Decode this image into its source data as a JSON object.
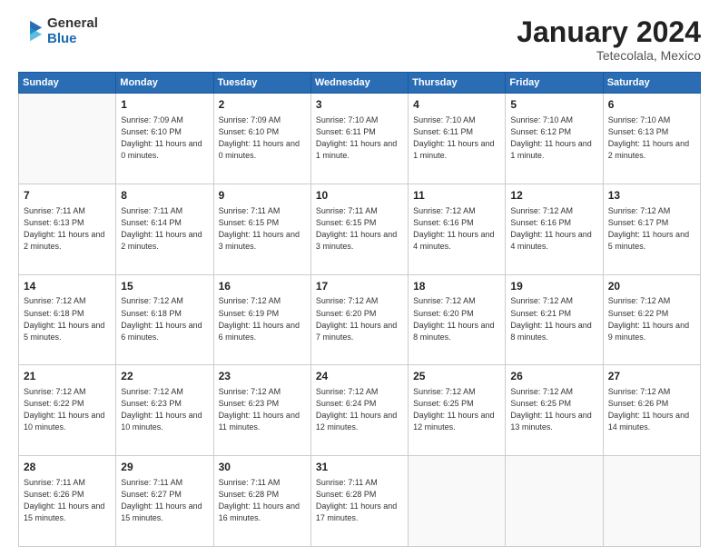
{
  "logo": {
    "general": "General",
    "blue": "Blue"
  },
  "title": {
    "month": "January 2024",
    "location": "Tetecolala, Mexico"
  },
  "days_of_week": [
    "Sunday",
    "Monday",
    "Tuesday",
    "Wednesday",
    "Thursday",
    "Friday",
    "Saturday"
  ],
  "weeks": [
    [
      {
        "day": "",
        "info": ""
      },
      {
        "day": "1",
        "info": "Sunrise: 7:09 AM\nSunset: 6:10 PM\nDaylight: 11 hours\nand 0 minutes."
      },
      {
        "day": "2",
        "info": "Sunrise: 7:09 AM\nSunset: 6:10 PM\nDaylight: 11 hours\nand 0 minutes."
      },
      {
        "day": "3",
        "info": "Sunrise: 7:10 AM\nSunset: 6:11 PM\nDaylight: 11 hours\nand 1 minute."
      },
      {
        "day": "4",
        "info": "Sunrise: 7:10 AM\nSunset: 6:11 PM\nDaylight: 11 hours\nand 1 minute."
      },
      {
        "day": "5",
        "info": "Sunrise: 7:10 AM\nSunset: 6:12 PM\nDaylight: 11 hours\nand 1 minute."
      },
      {
        "day": "6",
        "info": "Sunrise: 7:10 AM\nSunset: 6:13 PM\nDaylight: 11 hours\nand 2 minutes."
      }
    ],
    [
      {
        "day": "7",
        "info": "Sunrise: 7:11 AM\nSunset: 6:13 PM\nDaylight: 11 hours\nand 2 minutes."
      },
      {
        "day": "8",
        "info": "Sunrise: 7:11 AM\nSunset: 6:14 PM\nDaylight: 11 hours\nand 2 minutes."
      },
      {
        "day": "9",
        "info": "Sunrise: 7:11 AM\nSunset: 6:15 PM\nDaylight: 11 hours\nand 3 minutes."
      },
      {
        "day": "10",
        "info": "Sunrise: 7:11 AM\nSunset: 6:15 PM\nDaylight: 11 hours\nand 3 minutes."
      },
      {
        "day": "11",
        "info": "Sunrise: 7:12 AM\nSunset: 6:16 PM\nDaylight: 11 hours\nand 4 minutes."
      },
      {
        "day": "12",
        "info": "Sunrise: 7:12 AM\nSunset: 6:16 PM\nDaylight: 11 hours\nand 4 minutes."
      },
      {
        "day": "13",
        "info": "Sunrise: 7:12 AM\nSunset: 6:17 PM\nDaylight: 11 hours\nand 5 minutes."
      }
    ],
    [
      {
        "day": "14",
        "info": "Sunrise: 7:12 AM\nSunset: 6:18 PM\nDaylight: 11 hours\nand 5 minutes."
      },
      {
        "day": "15",
        "info": "Sunrise: 7:12 AM\nSunset: 6:18 PM\nDaylight: 11 hours\nand 6 minutes."
      },
      {
        "day": "16",
        "info": "Sunrise: 7:12 AM\nSunset: 6:19 PM\nDaylight: 11 hours\nand 6 minutes."
      },
      {
        "day": "17",
        "info": "Sunrise: 7:12 AM\nSunset: 6:20 PM\nDaylight: 11 hours\nand 7 minutes."
      },
      {
        "day": "18",
        "info": "Sunrise: 7:12 AM\nSunset: 6:20 PM\nDaylight: 11 hours\nand 8 minutes."
      },
      {
        "day": "19",
        "info": "Sunrise: 7:12 AM\nSunset: 6:21 PM\nDaylight: 11 hours\nand 8 minutes."
      },
      {
        "day": "20",
        "info": "Sunrise: 7:12 AM\nSunset: 6:22 PM\nDaylight: 11 hours\nand 9 minutes."
      }
    ],
    [
      {
        "day": "21",
        "info": "Sunrise: 7:12 AM\nSunset: 6:22 PM\nDaylight: 11 hours\nand 10 minutes."
      },
      {
        "day": "22",
        "info": "Sunrise: 7:12 AM\nSunset: 6:23 PM\nDaylight: 11 hours\nand 10 minutes."
      },
      {
        "day": "23",
        "info": "Sunrise: 7:12 AM\nSunset: 6:23 PM\nDaylight: 11 hours\nand 11 minutes."
      },
      {
        "day": "24",
        "info": "Sunrise: 7:12 AM\nSunset: 6:24 PM\nDaylight: 11 hours\nand 12 minutes."
      },
      {
        "day": "25",
        "info": "Sunrise: 7:12 AM\nSunset: 6:25 PM\nDaylight: 11 hours\nand 12 minutes."
      },
      {
        "day": "26",
        "info": "Sunrise: 7:12 AM\nSunset: 6:25 PM\nDaylight: 11 hours\nand 13 minutes."
      },
      {
        "day": "27",
        "info": "Sunrise: 7:12 AM\nSunset: 6:26 PM\nDaylight: 11 hours\nand 14 minutes."
      }
    ],
    [
      {
        "day": "28",
        "info": "Sunrise: 7:11 AM\nSunset: 6:26 PM\nDaylight: 11 hours\nand 15 minutes."
      },
      {
        "day": "29",
        "info": "Sunrise: 7:11 AM\nSunset: 6:27 PM\nDaylight: 11 hours\nand 15 minutes."
      },
      {
        "day": "30",
        "info": "Sunrise: 7:11 AM\nSunset: 6:28 PM\nDaylight: 11 hours\nand 16 minutes."
      },
      {
        "day": "31",
        "info": "Sunrise: 7:11 AM\nSunset: 6:28 PM\nDaylight: 11 hours\nand 17 minutes."
      },
      {
        "day": "",
        "info": ""
      },
      {
        "day": "",
        "info": ""
      },
      {
        "day": "",
        "info": ""
      }
    ]
  ]
}
